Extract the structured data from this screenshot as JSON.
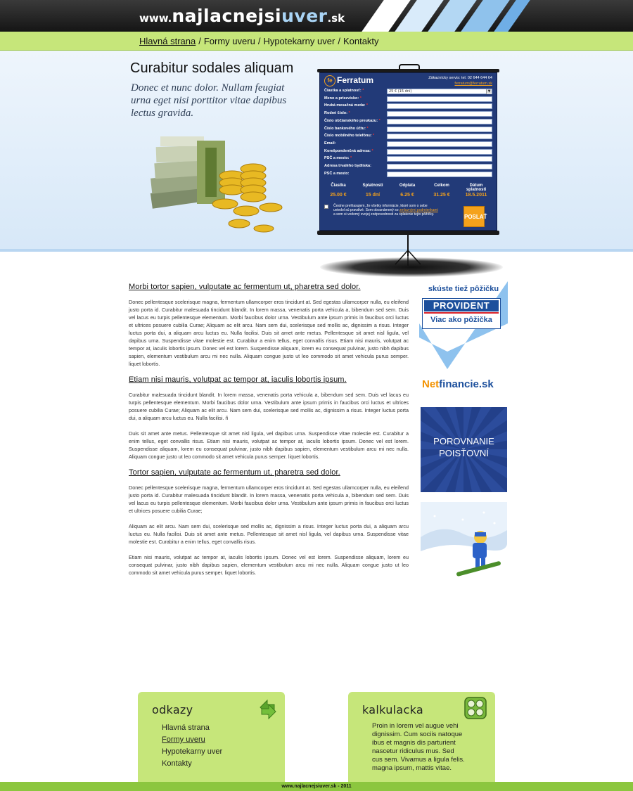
{
  "header": {
    "logo_prefix": "www.",
    "logo_main": "najlacnejsi",
    "logo_accent": "uver",
    "logo_tld": ".sk"
  },
  "nav": {
    "items": [
      {
        "label": "Hlavná strana",
        "active": true
      },
      {
        "label": "Formy uveru",
        "active": false
      },
      {
        "label": "Hypotekarny uver",
        "active": false
      },
      {
        "label": "Kontakty",
        "active": false
      }
    ],
    "separator": "/"
  },
  "hero": {
    "title": "Curabitur sodales aliquam",
    "subtitle": "Donec et nunc dolor. Nullam feugiat urna eget nisi porttitor vitae dapibus lectus gravida."
  },
  "form": {
    "brand": "Ferratum",
    "brand_mark": "fe",
    "contact_line": "Zákaznícky servis: tel. 02 644 644 64",
    "contact_email": "ferratum@ferratum.sk",
    "fields": [
      {
        "label": "Čiastka a splatnosť:",
        "required": true,
        "value": "25 € (15 dní)",
        "type": "select"
      },
      {
        "label": "Meno a priezvisko:",
        "required": true,
        "value": ""
      },
      {
        "label": "Hrubá mesačná mzda:",
        "required": true,
        "value": ""
      },
      {
        "label": "Rodné číslo:",
        "required": true,
        "value": ""
      },
      {
        "label": "Číslo občianského preukazu:",
        "required": true,
        "value": ""
      },
      {
        "label": "Číslo bankového účtu:",
        "required": true,
        "value": ""
      },
      {
        "label": "Číslo mobilného telefónu:",
        "required": true,
        "value": ""
      },
      {
        "label": "Email:",
        "required": false,
        "value": ""
      },
      {
        "label": "Korešpondenčná adresa:",
        "required": true,
        "value": ""
      },
      {
        "label": "PSČ a mesto:",
        "required": true,
        "value": ""
      },
      {
        "label": "Adresa trvalého bydliska:",
        "required": false,
        "value": ""
      },
      {
        "label": "PSČ a mesto:",
        "required": false,
        "value": ""
      }
    ],
    "summary": {
      "headers": [
        "Čiastka",
        "Splatnosti",
        "Odplata",
        "Celkom",
        "Dátum splatnosti"
      ],
      "values": [
        "25.00 €",
        "15 dní",
        "6.25 €",
        "31.25 €",
        "18.5.2011"
      ]
    },
    "agree_text_1": "Čestne prehlasujem, že všetky informácie, ktoré som o sebe uviedol sú pravdivé. Som oboznámený so",
    "agree_link": "zmluvnými podmienkami",
    "agree_text_2": "a som si vedomý svojej zodpovednosti za splatenie tejto pôžičky.",
    "submit_label": "POSLAŤ"
  },
  "main": {
    "sections": [
      {
        "heading": "Morbi tortor sapien, vulputate ac fermentum ut, pharetra sed dolor.",
        "paragraphs": [
          "Donec pellentesque scelerisque magna, fermentum ullamcorper eros tincidunt at. Sed egestas ullamcorper nulla, eu eleifend justo porta id. Curabitur malesuada tincidunt blandit. In lorem massa, venenatis porta vehicula a, bibendum sed sem. Duis vel lacus eu turpis pellentesque elementum. Morbi faucibus dolor urna. Vestibulum ante ipsum primis in faucibus orci luctus et ultrices posuere cubilia Curae; Aliquam ac elit arcu. Nam sem dui, scelerisque sed mollis ac, dignissim a risus. Integer luctus porta dui, a aliquam arcu luctus eu. Nulla facilisi. Duis sit amet ante metus. Pellentesque sit amet nisl ligula, vel dapibus urna. Suspendisse vitae molestie est. Curabitur a enim tellus, eget convallis risus. Etiam nisi mauris, volutpat ac tempor at, iaculis lobortis ipsum. Donec vel est lorem. Suspendisse aliquam, lorem eu consequat pulvinar, justo nibh dapibus sapien, elementum vestibulum arcu mi nec nulla. Aliquam congue justo ut leo commodo sit amet vehicula purus semper. liquet lobortis."
        ]
      },
      {
        "heading": "Etiam nisi mauris, volutpat ac tempor at, iaculis lobortis ipsum.",
        "paragraphs": [
          "Curabitur malesuada tincidunt blandit. In lorem massa, venenatis porta vehicula a, bibendum sed sem. Duis vel lacus eu turpis pellentesque elementum. Morbi faucibus dolor urna. Vestibulum ante ipsum primis in faucibus orci luctus et ultrices posuere cubilia Curae; Aliquam ac elit arcu. Nam sem dui, scelerisque sed mollis ac, dignissim a risus. Integer luctus porta dui, a aliquam arcu luctus eu. Nulla facilisi. ñ",
          "Duis sit amet ante metus. Pellentesque sit amet nisl ligula, vel dapibus urna. Suspendisse vitae molestie est. Curabitur a enim tellus, eget convallis risus. Etiam nisi mauris, volutpat ac tempor at, iaculis lobortis ipsum. Donec vel est lorem. Suspendisse aliquam, lorem eu consequat pulvinar, justo nibh dapibus sapien, elementum vestibulum arcu mi nec nulla. Aliquam congue justo ut leo commodo sit amet vehicula purus semper. liquet lobortis."
        ]
      },
      {
        "heading": "Tortor sapien, vulputate ac fermentum ut, pharetra sed dolor.",
        "paragraphs": [
          "Donec pellentesque scelerisque magna, fermentum ullamcorper eros tincidunt at. Sed egestas ullamcorper nulla, eu eleifend justo porta id. Curabitur malesuada tincidunt blandit. In lorem massa, venenatis porta vehicula a, bibendum sed sem. Duis vel lacus eu turpis pellentesque elementum. Morbi faucibus dolor urna. Vestibulum ante ipsum primis in faucibus orci luctus et ultrices posuere cubilia Curae;",
          "Aliquam ac elit arcu. Nam sem dui, scelerisque sed mollis ac, dignissim a risus. Integer luctus porta dui, a aliquam arcu luctus eu. Nulla facilisi. Duis sit amet ante metus. Pellentesque sit amet nisl ligula, vel dapibus urna. Suspendisse vitae molestie est. Curabitur a enim tellus, eget convallis risus.",
          "Etiam nisi mauris, volutpat ac tempor at, iaculis lobortis ipsum. Donec vel est lorem. Suspendisse aliquam, lorem eu consequat pulvinar, justo nibh dapibus sapien, elementum vestibulum arcu mi nec nulla. Aliquam congue justo ut leo commodo sit amet vehicula purus semper. liquet lobortis."
        ]
      }
    ]
  },
  "ads": {
    "provident_title": "skúste tiež pôžičku",
    "provident_name": "PROVIDENT",
    "provident_tag": "Viac ako pôžička",
    "net_part1": "Net",
    "net_part2": "financie.sk",
    "porov_line1": "POROVNANIE",
    "porov_line2": "POISŤOVNÍ"
  },
  "footer": {
    "links_title": "odkazy",
    "links": [
      {
        "label": "Hlavná strana",
        "active": false
      },
      {
        "label": "Formy uveru",
        "active": true
      },
      {
        "label": "Hypotekarny uver",
        "active": false
      },
      {
        "label": "Kontakty",
        "active": false
      }
    ],
    "calc_title": "kalkulacka",
    "calc_text": "Proin in lorem vel augue vehi dignissim. Cum sociis natoque ibus et magnis dis parturient nascetur ridiculus mus. Sed cus sem. Vivamus a ligula felis. magna ipsum, mattis vitae.",
    "copyright_site": "www.najlacnejsiuver.sk",
    "copyright_year": "- 2011"
  },
  "colors": {
    "green": "#c6e67a",
    "green_dark": "#8cc63f",
    "form_blue": "#223a78",
    "orange": "#f6a21a",
    "provident_blue": "#1c4f9c"
  }
}
